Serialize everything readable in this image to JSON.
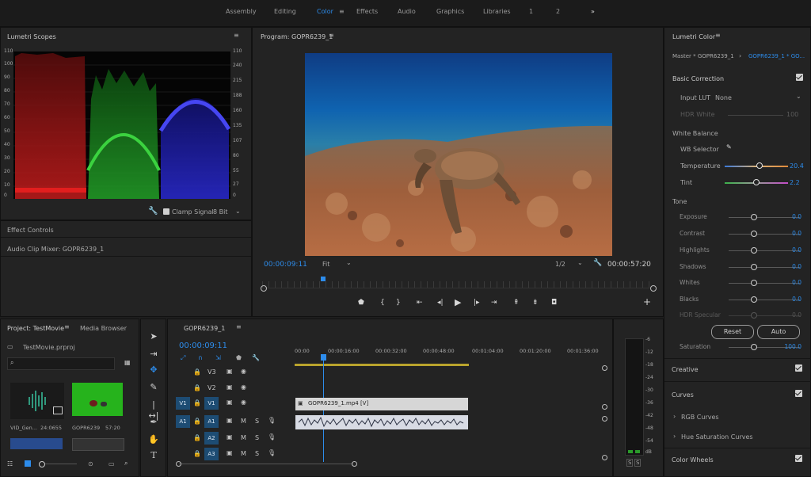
{
  "topbar": {
    "workspaces": [
      "Assembly",
      "Editing",
      "Color",
      "Effects",
      "Audio",
      "Graphics",
      "Libraries"
    ],
    "active": "Color",
    "extra": [
      "1",
      "2"
    ],
    "more": "»"
  },
  "scopes": {
    "title": "Lumetri Scopes",
    "left_ticks": [
      "110",
      "100",
      "90",
      "80",
      "70",
      "60",
      "50",
      "40",
      "30",
      "20",
      "10",
      "0"
    ],
    "right_ticks": [
      "110",
      "240",
      "215",
      "188",
      "160",
      "135",
      "107",
      "80",
      "55",
      "27",
      "0"
    ],
    "clamp_label": "Clamp Signal",
    "bit_label": "8 Bit"
  },
  "effect_controls": {
    "title": "Effect Controls",
    "audio_mixer": "Audio Clip Mixer: GOPR6239_1"
  },
  "program": {
    "title": "Program: GOPR6239_1",
    "timecode": "00:00:09:11",
    "fit": "Fit",
    "quality": "1/2",
    "duration": "00:00:57:20"
  },
  "project": {
    "tab1": "Project: TestMovie",
    "tab2": "Media Browser",
    "file": "TestMovie.prproj",
    "thumb1_name": "VID_Gen...",
    "thumb1_dur": "24:0655",
    "thumb2_name": "GOPR6239",
    "thumb2_dur": "57:20"
  },
  "timeline": {
    "tab": "GOPR6239_1",
    "timecode": "00:00:09:11",
    "ruler": [
      "00:00",
      "00:00:16:00",
      "00:00:32:00",
      "00:00:48:00",
      "00:01:04:00",
      "00:01:20:00",
      "00:01:36:00"
    ],
    "tracks_video": [
      "V3",
      "V2",
      "V1"
    ],
    "tracks_audio": [
      "A1",
      "A2",
      "A3"
    ],
    "clip_label": "GOPR6239_1.mp4 [V]",
    "meter_ticks": [
      "-6",
      "-12",
      "-18",
      "-24",
      "-30",
      "-36",
      "-42",
      "-48",
      "-54",
      "dB"
    ],
    "meter_ss": [
      "S",
      "S"
    ]
  },
  "lumetri": {
    "title": "Lumetri Color",
    "master": "Master * GOPR6239_1",
    "seq": "GOPR6239_1 * GO...",
    "basic": "Basic Correction",
    "input_lut": "Input LUT",
    "input_lut_val": "None",
    "hdr_white": "HDR White",
    "hdr_val": "100",
    "white_balance": "White Balance",
    "wb_selector": "WB Selector",
    "tone": "Tone",
    "reset": "Reset",
    "auto": "Auto",
    "saturation": "Saturation",
    "saturation_val": "100.0",
    "sliders": [
      {
        "label": "Temperature",
        "value": "20.4"
      },
      {
        "label": "Tint",
        "value": "2.2"
      }
    ],
    "tone_sliders": [
      {
        "label": "Exposure",
        "value": "0.0"
      },
      {
        "label": "Contrast",
        "value": "0.0"
      },
      {
        "label": "Highlights",
        "value": "0.0"
      },
      {
        "label": "Shadows",
        "value": "0.0"
      },
      {
        "label": "Whites",
        "value": "0.0"
      },
      {
        "label": "Blacks",
        "value": "0.0"
      },
      {
        "label": "HDR Specular",
        "value": "0.0"
      }
    ],
    "sections": [
      "Creative",
      "Curves",
      "Color Wheels"
    ],
    "rgb_curves": "RGB Curves",
    "hue_sat": "Hue Saturation Curves"
  },
  "colors": {
    "accent": "#2d8ceb",
    "track_blue": "#1d4c73",
    "clip_audio": "#d8dbe4"
  }
}
